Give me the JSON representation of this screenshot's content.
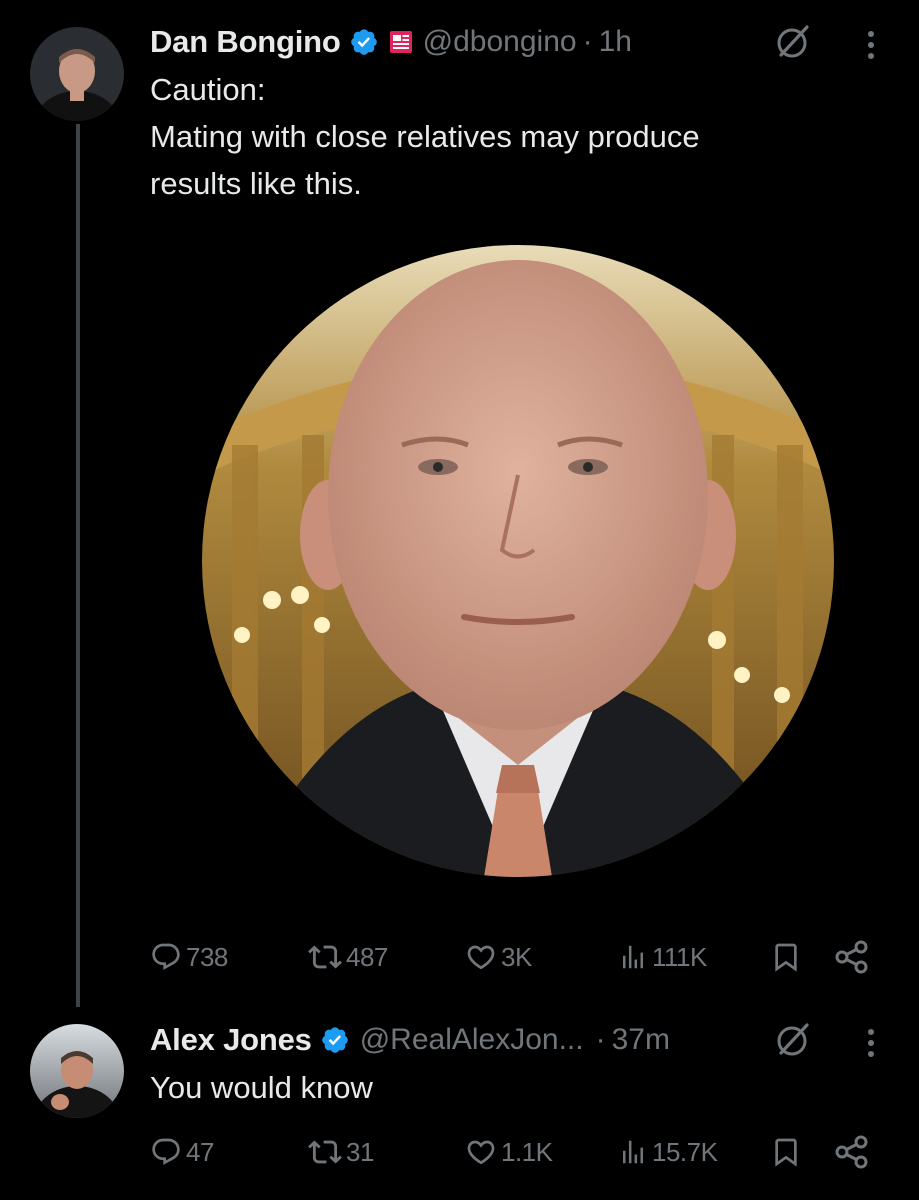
{
  "tweet1": {
    "author_name": "Dan Bongino",
    "handle": "@dbongino",
    "separator": "·",
    "time": "1h",
    "text": "Caution:\nMating with close relatives may produce\nresults like this.",
    "icons": {
      "avatar": "avatar",
      "verified": "verified-badge-icon",
      "affiliation": "news-affiliation-icon",
      "grok": "grok-icon",
      "more": "more-icon"
    },
    "stats": {
      "replies": "738",
      "reposts": "487",
      "likes": "3K",
      "views": "111K"
    }
  },
  "tweet2": {
    "author_name": "Alex Jones",
    "handle": "@RealAlexJon...",
    "separator": "·",
    "time": "37m",
    "text": "You would know",
    "icons": {
      "avatar": "avatar",
      "verified": "verified-badge-icon",
      "grok": "grok-icon",
      "more": "more-icon"
    },
    "stats": {
      "replies": "47",
      "reposts": "31",
      "likes": "1.1K",
      "views": "15.7K"
    }
  },
  "colors": {
    "background": "#000000",
    "primary_text": "#e7e9ea",
    "secondary_text": "#71767b",
    "verified_blue": "#1d9bf0",
    "thread_line": "#3f4347",
    "affiliation_red": "#e0245e"
  }
}
